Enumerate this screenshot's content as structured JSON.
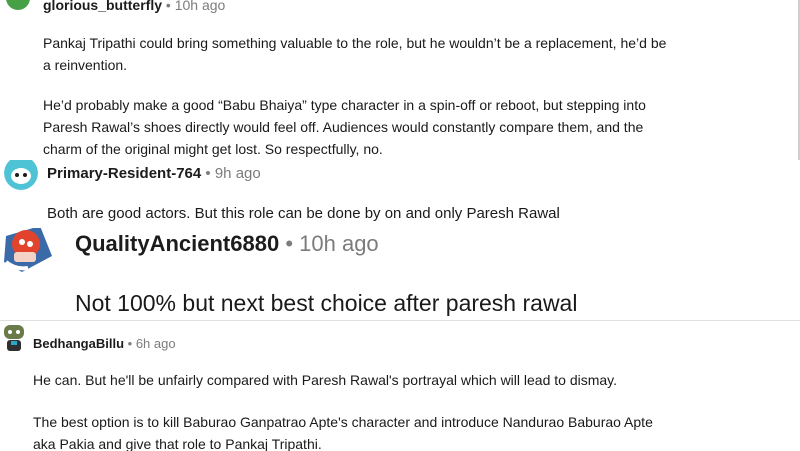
{
  "comments": [
    {
      "username": "glorious_butterfly",
      "time": "10h ago",
      "paragraphs": [
        "Pankaj Tripathi could bring something valuable to the role, but he wouldn’t be a replacement, he’d be",
        "a reinvention.",
        "He’d probably make a good “Babu Bhaiya” type character in a spin-off or reboot, but stepping into",
        "Paresh Rawal’s shoes directly would feel off. Audiences would constantly compare them, and the",
        "charm of the original might get lost. So respectfully, no."
      ]
    },
    {
      "username": "Primary-Resident-764",
      "time": "9h ago",
      "paragraphs": [
        "Both are good actors. But this role can be done by on and only Paresh Rawal"
      ]
    },
    {
      "username": "QualityAncient6880",
      "time": "10h ago",
      "paragraphs": [
        "Not 100% but next best choice after paresh rawal"
      ]
    },
    {
      "username": "BedhangaBillu",
      "time": "6h ago",
      "paragraphs": [
        "He can. But he'll be unfairly compared with Paresh Rawal's portrayal which will lead to dismay.",
        "The best option is to kill Baburao Ganpatrao Apte's character and introduce Nandurao Baburao Apte",
        "aka Pakia and give that role to Pankaj Tripathi."
      ]
    }
  ],
  "separator": "•",
  "colors": {
    "text": "#1a1a1b",
    "meta": "#7c7c7c",
    "avatar_green": "#46a046",
    "avatar_teal": "#4fc3d6"
  },
  "icons": [
    "avatar-green",
    "snoo-avatar-teal",
    "snoo-avatar-red",
    "snoo-avatar-dark"
  ]
}
